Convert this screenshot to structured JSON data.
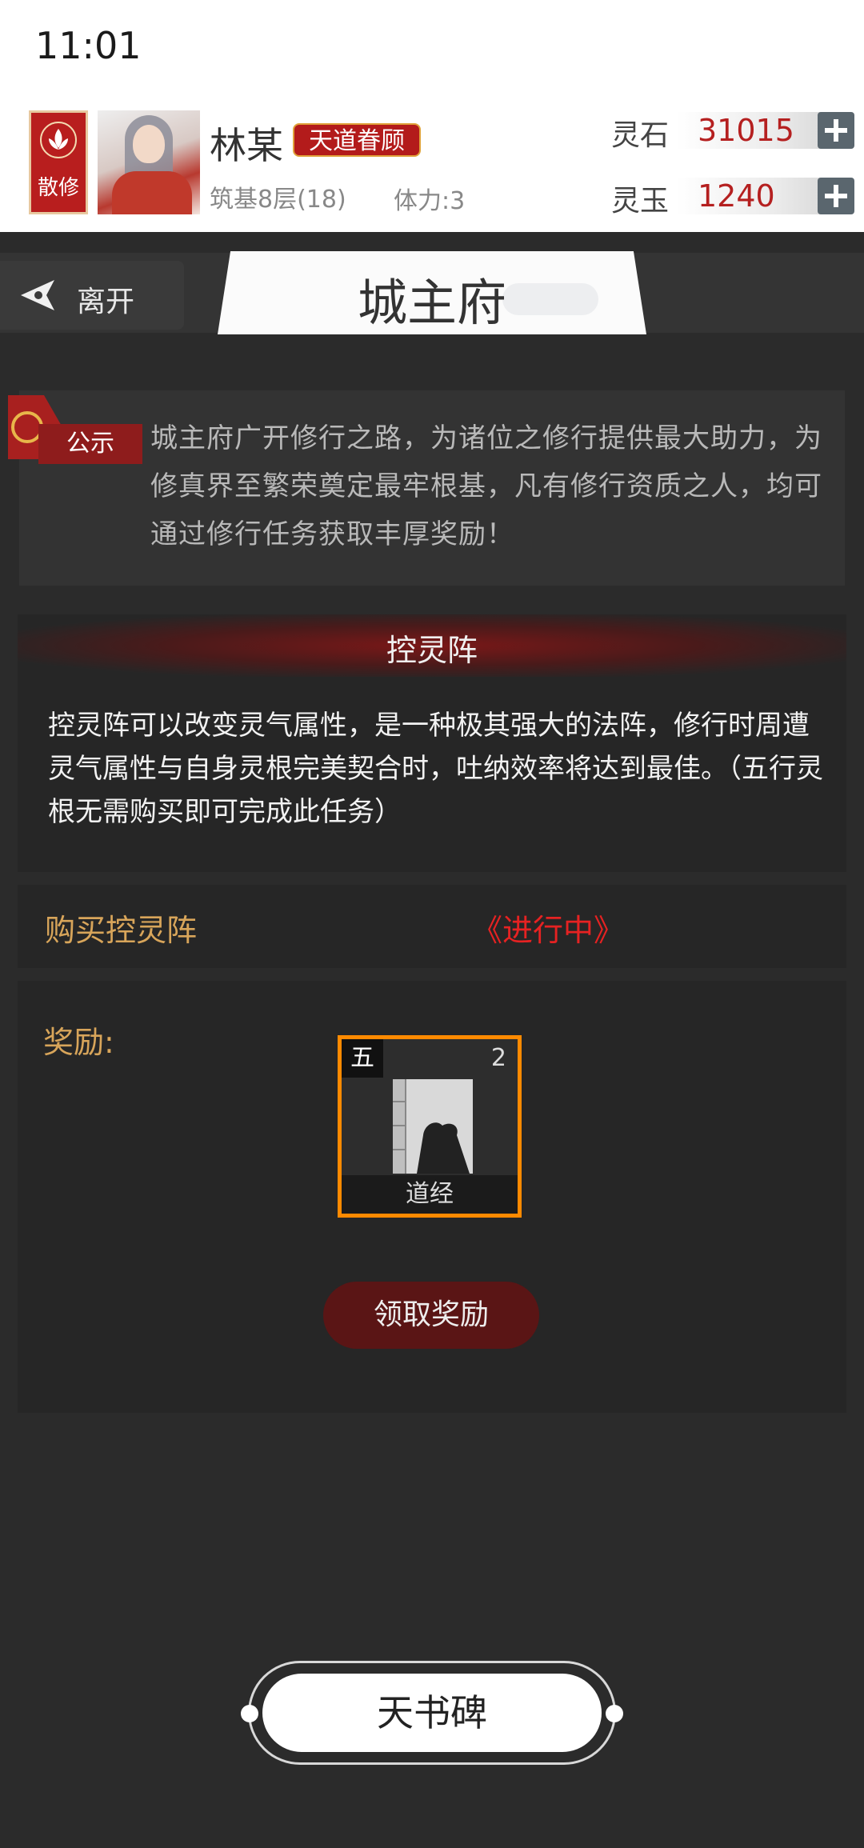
{
  "status_bar": {
    "time": "11:01"
  },
  "player": {
    "sect": "散修",
    "name": "林某",
    "title": "天道眷顾",
    "realm": "筑基8层(18)",
    "stamina": "体力:3",
    "avatar": "character-portrait"
  },
  "currencies": [
    {
      "label": "灵石",
      "value": "31015"
    },
    {
      "label": "灵玉",
      "value": "1240"
    }
  ],
  "nav": {
    "leave_label": "离开",
    "title": "城主府"
  },
  "notice": {
    "tag": "公示",
    "text": "城主府广开修行之路，为诸位之修行提供最大助力，为修真界至繁荣奠定最牢根基，凡有修行资质之人，均可通过修行任务获取丰厚奖励！"
  },
  "task": {
    "name": "控灵阵",
    "description": "控灵阵可以改变灵气属性，是一种极其强大的法阵，修行时周遭灵气属性与自身灵根完美契合时，吐纳效率将达到最佳。（五行灵根无需购买即可完成此任务）",
    "requirement_label": "购买控灵阵",
    "status": "《进行中》"
  },
  "reward": {
    "label": "奖励:",
    "item": {
      "grade": "五",
      "count": "2",
      "name": "道经",
      "icon": "scripture-book-icon"
    },
    "claim_label": "领取奖励"
  },
  "bottom_button": {
    "label": "天书碑"
  },
  "colors": {
    "accent_red": "#b31b1b",
    "gold_text": "#d8a55a",
    "status_red": "#e62222",
    "item_border": "#ff8a00",
    "background": "#2b2b2b"
  }
}
